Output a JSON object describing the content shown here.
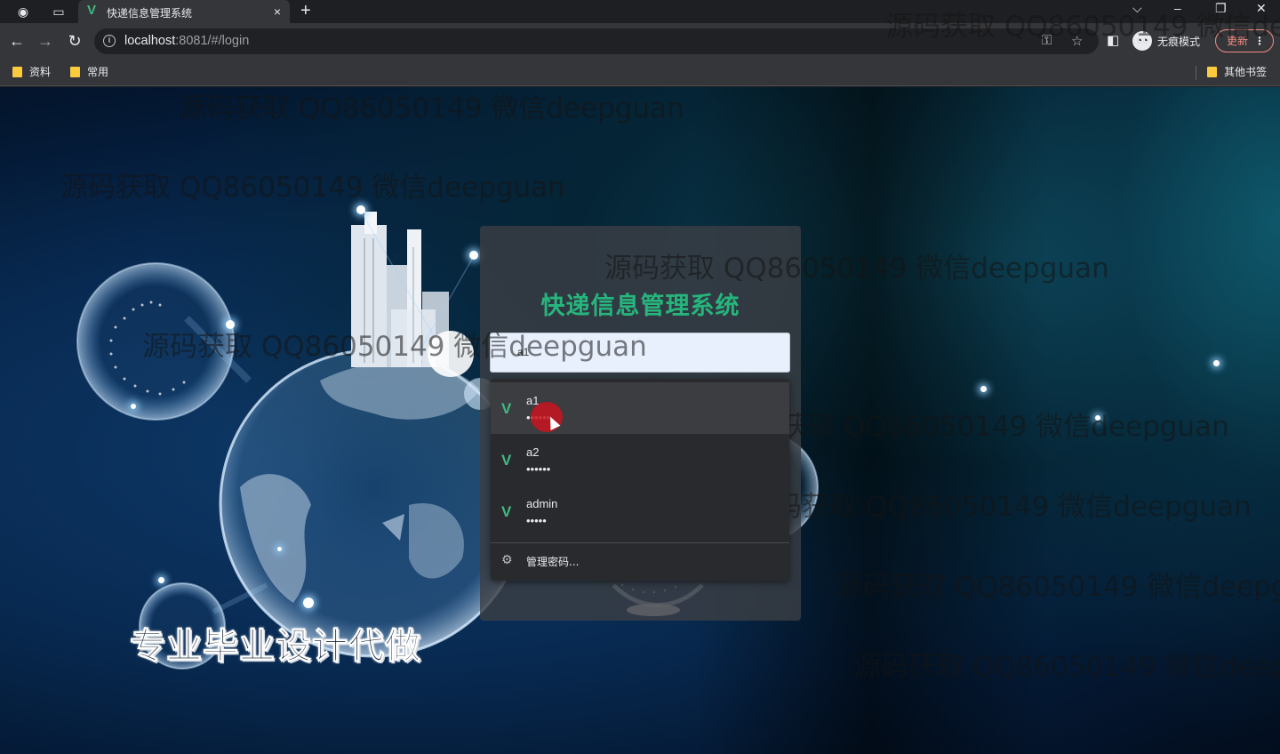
{
  "browser": {
    "tab": {
      "title": "快递信息管理系统",
      "favicon": "vue-logo-icon",
      "close": "×"
    },
    "new_tab": "+",
    "window_controls": {
      "dropdown": "⌵",
      "minimize": "–",
      "restore": "❐",
      "close": "✕"
    },
    "address": {
      "host": "localhost",
      "rest": ":8081/#/login"
    },
    "incognito_label": "无痕模式",
    "update_label": "更新",
    "bookmarks": [
      {
        "label": "资料"
      },
      {
        "label": "常用"
      }
    ],
    "other_bookmarks": "其他书签"
  },
  "login": {
    "title": "快递信息管理系统",
    "username_value": "a1"
  },
  "autofill": {
    "items": [
      {
        "user": "a1",
        "password_mask": "••••••"
      },
      {
        "user": "a2",
        "password_mask": "••••••"
      },
      {
        "user": "admin",
        "password_mask": "•••••"
      }
    ],
    "manage_label": "管理密码..."
  },
  "promo_text": "专业毕业设计代做",
  "watermark_text": "源码获取 QQ86050149 微信deepguan",
  "colors": {
    "accent": "#26b57c",
    "vue_green": "#41b883",
    "update_red": "#f28b82"
  }
}
